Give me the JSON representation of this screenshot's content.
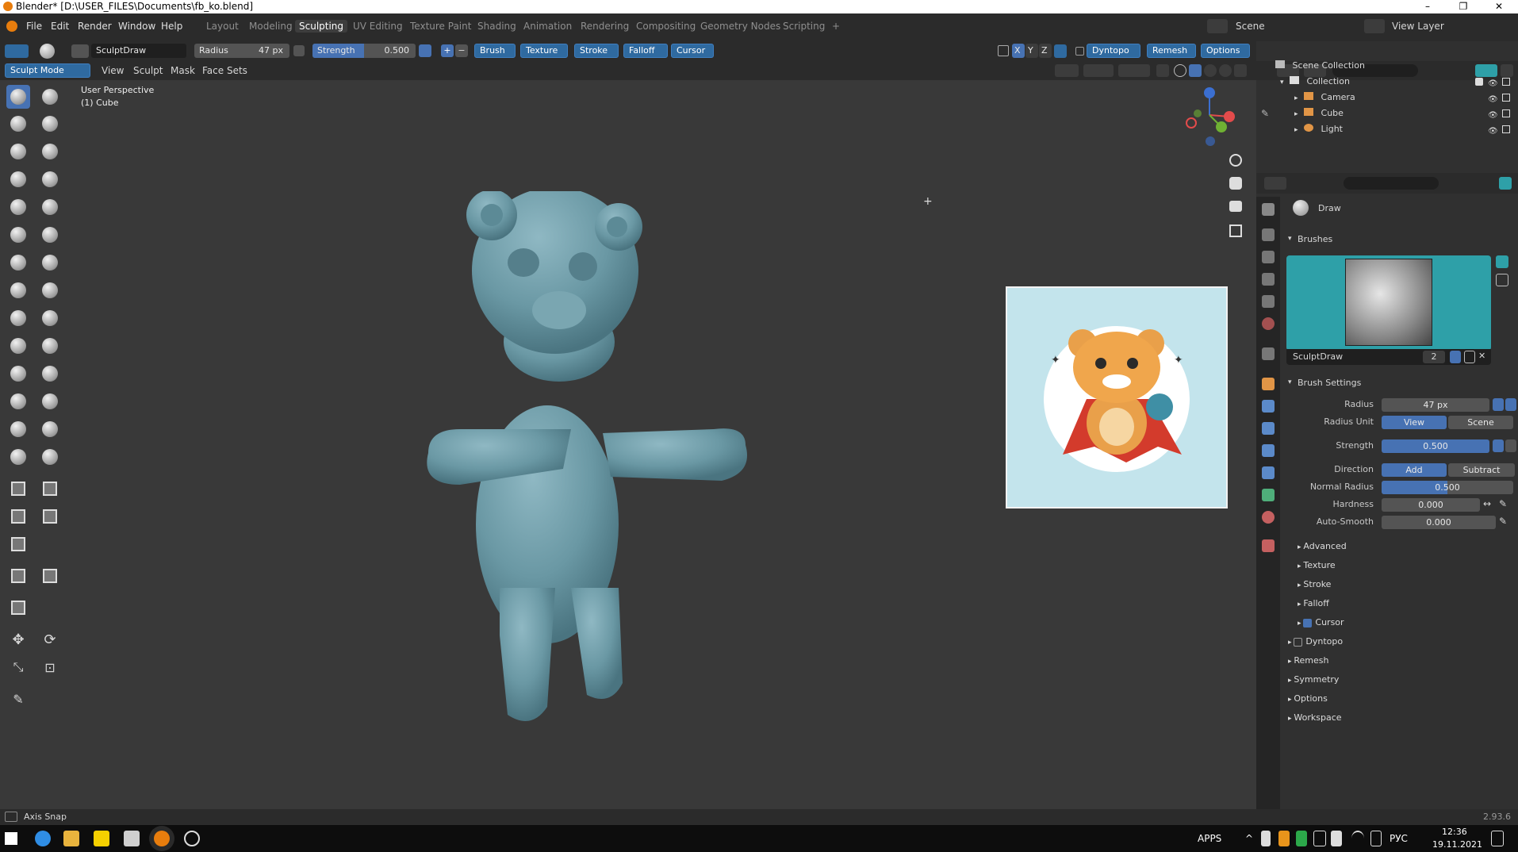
{
  "window": {
    "title": "Blender* [D:\\USER_FILES\\Documents\\fb_ko.blend]"
  },
  "menus": [
    "File",
    "Edit",
    "Render",
    "Window",
    "Help"
  ],
  "workspaces": [
    "Layout",
    "Modeling",
    "Sculpting",
    "UV Editing",
    "Texture Paint",
    "Shading",
    "Animation",
    "Rendering",
    "Compositing",
    "Geometry Nodes",
    "Scripting",
    "+"
  ],
  "active_workspace": "Sculpting",
  "scene": "Scene",
  "view_layer": "View Layer",
  "tool_header": {
    "brush_name": "SculptDraw",
    "radius_label": "Radius",
    "radius_value": "47 px",
    "strength_label": "Strength",
    "strength_value": "0.500",
    "dropdowns": [
      "Brush",
      "Texture",
      "Stroke",
      "Falloff",
      "Cursor"
    ],
    "axis": [
      "X",
      "Y",
      "Z"
    ],
    "dyntopo": "Dyntopo",
    "remesh": "Remesh",
    "options": "Options"
  },
  "viewport_header": {
    "mode": "Sculpt Mode",
    "menus": [
      "View",
      "Sculpt",
      "Mask",
      "Face Sets"
    ]
  },
  "viewport": {
    "perspective": "User Perspective",
    "object": "(1) Cube"
  },
  "outliner": {
    "root": "Scene Collection",
    "collection": "Collection",
    "items": [
      "Camera",
      "Cube",
      "Light"
    ]
  },
  "properties": {
    "active_brush": "Draw",
    "brushes_panel": "Brushes",
    "brush_datablock": "SculptDraw",
    "brush_users": "2",
    "brush_settings": "Brush Settings",
    "radius_label": "Radius",
    "radius_value": "47 px",
    "radius_unit_label": "Radius Unit",
    "radius_unit_view": "View",
    "radius_unit_scene": "Scene",
    "strength_label": "Strength",
    "strength_value": "0.500",
    "strength_fraction": 0.5,
    "direction_label": "Direction",
    "direction_add": "Add",
    "direction_subtract": "Subtract",
    "normal_radius_label": "Normal Radius",
    "normal_radius_value": "0.500",
    "normal_radius_fraction": 0.5,
    "hardness_label": "Hardness",
    "hardness_value": "0.000",
    "autosmooth_label": "Auto-Smooth",
    "autosmooth_value": "0.000",
    "subpanels": [
      "Advanced",
      "Texture",
      "Stroke",
      "Falloff",
      "Cursor"
    ],
    "cursor_checked": true,
    "panels": [
      "Dyntopo",
      "Remesh",
      "Symmetry",
      "Options",
      "Workspace"
    ],
    "dyntopo_checked": false
  },
  "status": {
    "left": "Axis Snap",
    "version": "2.93.6"
  },
  "taskbar": {
    "apps": "APPS",
    "lang": "РУС",
    "time": "12:36",
    "date": "19.11.2021"
  },
  "colors": {
    "accent": "#4772b3",
    "teal": "#2ea0a8",
    "mesh": "#6b9aa6"
  }
}
